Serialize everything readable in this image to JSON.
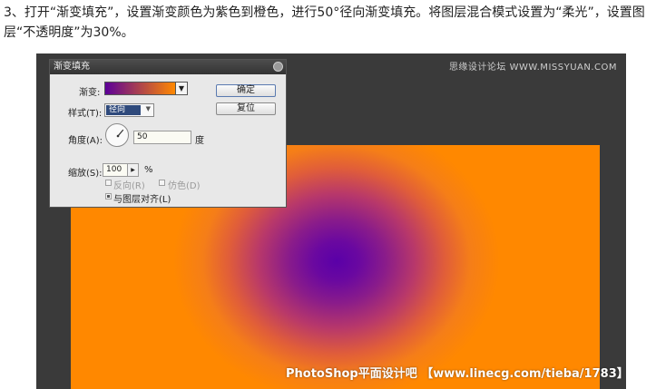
{
  "instruction": {
    "text": "3、打开“渐变填充”，设置渐变颜色为紫色到橙色，进行50°径向渐变填充。将图层混合模式设置为“柔光”，设置图层“不透明度”为30%。"
  },
  "watermarks": {
    "top": "思缘设计论坛 WWW.MISSYUAN.COM",
    "bottom": "PhotoShop平面设计吧 【www.linecg.com/tieba/1783】"
  },
  "dialog": {
    "title": "渐变填充",
    "gradient_label": "渐变:",
    "gradient_colors": [
      "#5c0099",
      "#ff8800"
    ],
    "style_label": "样式(T):",
    "style_value": "径向",
    "angle_label": "角度(A):",
    "angle_value": "50",
    "angle_unit": "度",
    "scale_label": "缩放(S):",
    "scale_value": "100",
    "scale_unit": "%",
    "reverse_label": "反向(R)",
    "reverse_checked": false,
    "dither_label": "仿色(D)",
    "dither_checked": false,
    "align_label": "与图层对齐(L)",
    "align_checked": true,
    "ok_label": "确定",
    "reset_label": "复位"
  },
  "colors": {
    "canvas_inner": "#5a00a8",
    "canvas_outer": "#ff8800",
    "workspace_bg": "#3a3a3a"
  },
  "icons": {
    "close": "close-icon",
    "dropdown": "chevron-down-icon",
    "angle": "angle-dial-icon"
  }
}
